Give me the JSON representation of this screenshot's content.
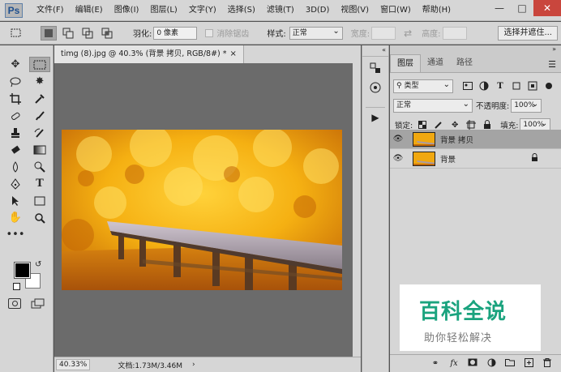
{
  "app": {
    "logo": "Ps",
    "menu": [
      "文件(F)",
      "编辑(E)",
      "图像(I)",
      "图层(L)",
      "文字(Y)",
      "选择(S)",
      "滤镜(T)",
      "3D(D)",
      "视图(V)",
      "窗口(W)",
      "帮助(H)"
    ]
  },
  "options": {
    "feather_label": "羽化:",
    "feather_value": "0 像素",
    "antialias_label": "消除锯齿",
    "style_label": "样式:",
    "style_value": "正常",
    "width_label": "宽度:",
    "height_label": "高度:",
    "select_mask_button": "选择并遮住..."
  },
  "document": {
    "tab_title": "timg (8).jpg @ 40.3% (背景 拷贝, RGB/8#) *",
    "tab_close": "×",
    "zoom": "40.33%",
    "doc_info": "文档:1.73M/3.46M",
    "status_arrow": "›"
  },
  "layers_panel": {
    "tabs": [
      "图层",
      "通道",
      "路径"
    ],
    "active_tab": "图层",
    "filter_kind": "类型",
    "blend_mode": "正常",
    "opacity_label": "不透明度:",
    "opacity_value": "100%",
    "lock_label": "锁定:",
    "fill_label": "填充:",
    "fill_value": "100%",
    "layers": [
      {
        "name": "背景 拷贝",
        "selected": true,
        "locked": false
      },
      {
        "name": "背景",
        "selected": false,
        "locked": true
      }
    ]
  },
  "watermark": {
    "title": "百科全说",
    "subtitle": "助你轻松解决"
  }
}
